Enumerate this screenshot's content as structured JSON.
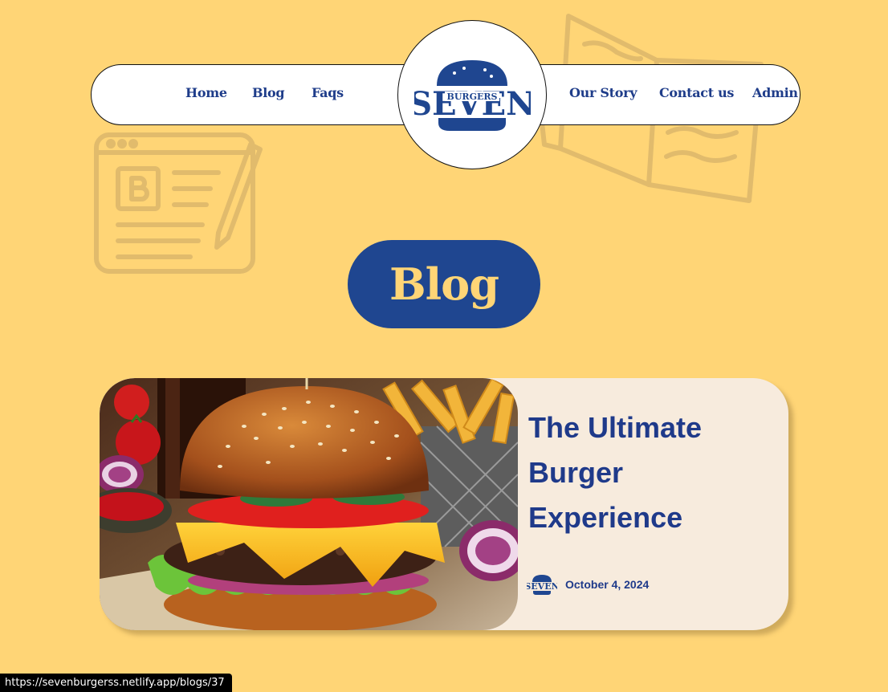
{
  "nav": {
    "left_links": [
      "Home",
      "Blog",
      "Faqs"
    ],
    "right_links": [
      "Our Story",
      "Contact us",
      "Admin"
    ],
    "logo": {
      "word": "SEVEN",
      "sub": "BURGERS"
    }
  },
  "hero": {
    "title": "Blog"
  },
  "post": {
    "title": "The Ultimate Burger Experience",
    "date": "October 4, 2024",
    "image": "burger-photo"
  },
  "status_bar": {
    "url": "https://sevenburgerss.netlify.app/blogs/37"
  },
  "colors": {
    "background": "#FFD576",
    "brand_blue": "#1F4690",
    "card": "#F7EBDD"
  }
}
